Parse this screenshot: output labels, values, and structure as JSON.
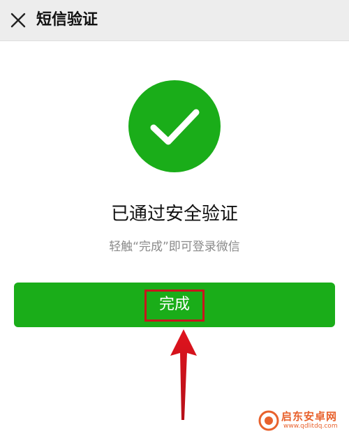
{
  "header": {
    "title": "短信验证",
    "close_icon": "close-icon",
    "background": "#ededed"
  },
  "status": {
    "icon": "checkmark-icon",
    "color": "#1aad19",
    "title": "已通过安全验证",
    "subtitle": "轻触“完成”即可登录微信"
  },
  "action": {
    "done_label": "完成",
    "button_color": "#1aad19",
    "highlight_color": "#c8161d"
  },
  "annotation": {
    "arrow_icon": "up-arrow-icon",
    "arrow_color": "#e0141e"
  },
  "watermark": {
    "name": "启东安卓网",
    "url": "www.qdlitdq.com",
    "color": "#e8612c"
  }
}
